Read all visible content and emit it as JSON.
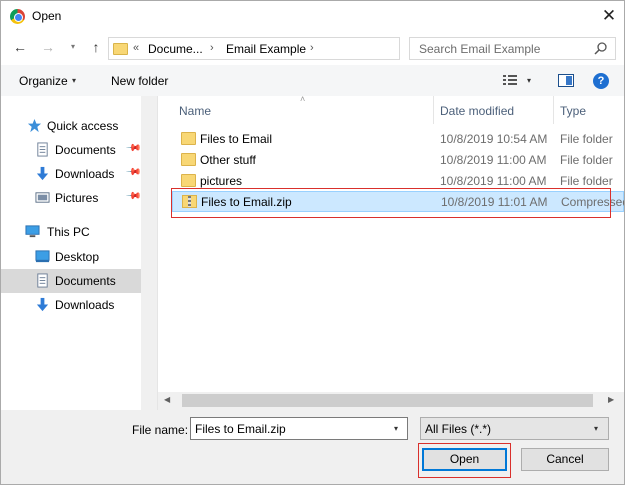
{
  "window": {
    "title": "Open",
    "close_glyph": "✕"
  },
  "nav": {
    "back_glyph": "←",
    "forward_glyph": "→",
    "recent_glyph": "▾",
    "up_glyph": "↑",
    "address": {
      "chev0": "«",
      "crumb1": "Docume...",
      "chev1": "›",
      "crumb2": "Email Example",
      "chev2": "›",
      "dropdown_glyph": "▾",
      "refresh_glyph": "↻"
    },
    "search_placeholder": "Search Email Example"
  },
  "toolbar": {
    "organize": "Organize",
    "organize_dd": "▾",
    "new_folder": "New folder",
    "view_dd": "▾",
    "help": "?"
  },
  "sidebar": {
    "items": [
      {
        "label": "Quick access",
        "icon": "star-icon"
      },
      {
        "label": "Documents",
        "icon": "documents-icon",
        "pinned": true
      },
      {
        "label": "Downloads",
        "icon": "download-icon",
        "pinned": true
      },
      {
        "label": "Pictures",
        "icon": "pictures-icon",
        "pinned": true
      },
      {
        "label": "This PC",
        "icon": "computer-icon"
      },
      {
        "label": "Desktop",
        "icon": "desktop-icon"
      },
      {
        "label": "Documents",
        "icon": "documents-icon",
        "selected": true
      },
      {
        "label": "Downloads",
        "icon": "download-icon"
      }
    ],
    "pin_glyph": "📌"
  },
  "columns": {
    "name": "Name",
    "date_modified": "Date modified",
    "type": "Type",
    "sort_glyph": "˄"
  },
  "files": [
    {
      "name": "Files to Email",
      "date": "10/8/2019 10:54 AM",
      "type": "File folder",
      "kind": "folder"
    },
    {
      "name": "Other stuff",
      "date": "10/8/2019 11:00 AM",
      "type": "File folder",
      "kind": "folder"
    },
    {
      "name": "pictures",
      "date": "10/8/2019 11:00 AM",
      "type": "File folder",
      "kind": "folder"
    },
    {
      "name": "Files to Email.zip",
      "date": "10/8/2019 11:01 AM",
      "type": "Compressed",
      "kind": "zip",
      "selected": true
    }
  ],
  "scroll": {
    "left_glyph": "◀",
    "right_glyph": "▶"
  },
  "bottom": {
    "filename_label": "File name:",
    "filename_value": "Files to Email.zip",
    "filename_dd": "▾",
    "filter_value": "All Files (*.*)",
    "filter_dd": "▾",
    "open_label": "Open",
    "cancel_label": "Cancel"
  },
  "colors": {
    "selection": "#cce8ff",
    "highlight_outline": "#d9302c",
    "accent": "#0078d7"
  }
}
